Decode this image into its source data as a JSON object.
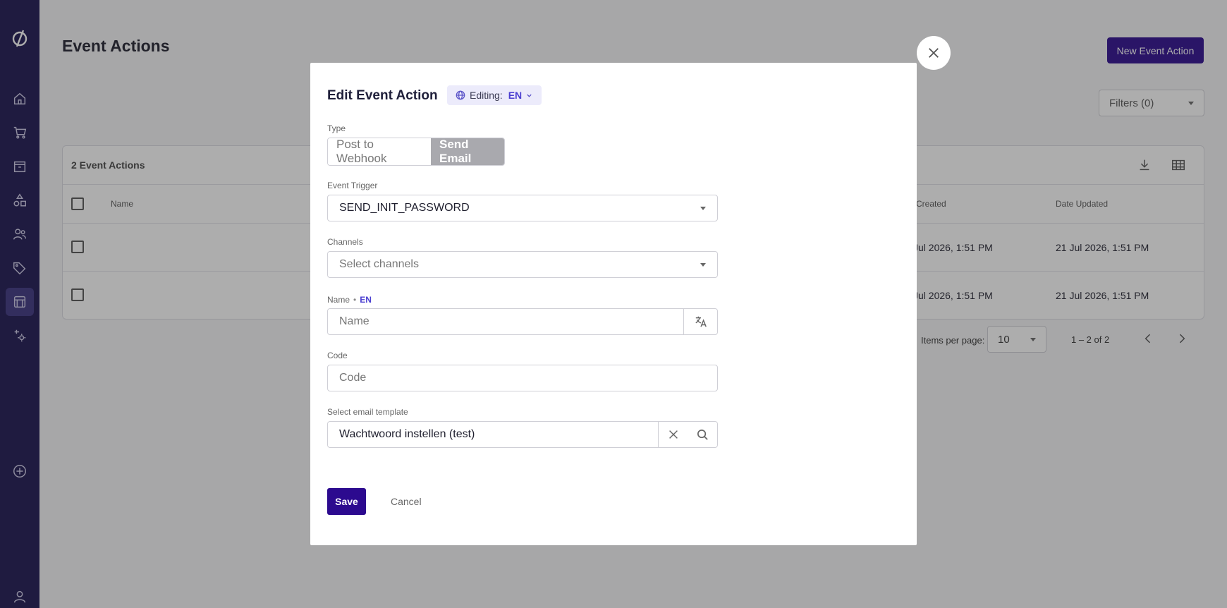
{
  "page": {
    "title": "Event Actions",
    "new_button": "New Event Action",
    "filters_label": "Filters (0)"
  },
  "table": {
    "count_label": "2 Event Actions",
    "headers": {
      "name": "Name",
      "created": "e Created",
      "updated": "Date Updated"
    },
    "rows": [
      {
        "created": "Jul 2026, 1:51 PM",
        "updated": "21 Jul 2026, 1:51 PM"
      },
      {
        "created": "Jul 2026, 1:51 PM",
        "updated": "21 Jul 2026, 1:51 PM"
      }
    ]
  },
  "pagination": {
    "items_per_page_label": "Items per page:",
    "items_per_page_value": "10",
    "range": "1 – 2 of 2"
  },
  "modal": {
    "title": "Edit Event Action",
    "editing_label": "Editing:",
    "editing_lang": "EN",
    "type_label": "Type",
    "type_options": [
      "Post to Webhook",
      "Send Email"
    ],
    "type_selected": "Send Email",
    "event_trigger_label": "Event Trigger",
    "event_trigger_value": "SEND_INIT_PASSWORD",
    "channels_label": "Channels",
    "channels_placeholder": "Select channels",
    "name_label": "Name",
    "name_lang": "EN",
    "name_placeholder": "Name",
    "code_label": "Code",
    "code_placeholder": "Code",
    "email_template_label": "Select email template",
    "email_template_value": "Wachtwoord instellen (test)",
    "save_label": "Save",
    "cancel_label": "Cancel"
  },
  "colors": {
    "sidebar_bg": "#1b1450",
    "primary": "#2c0a8f",
    "accent": "#4b3fd1"
  }
}
